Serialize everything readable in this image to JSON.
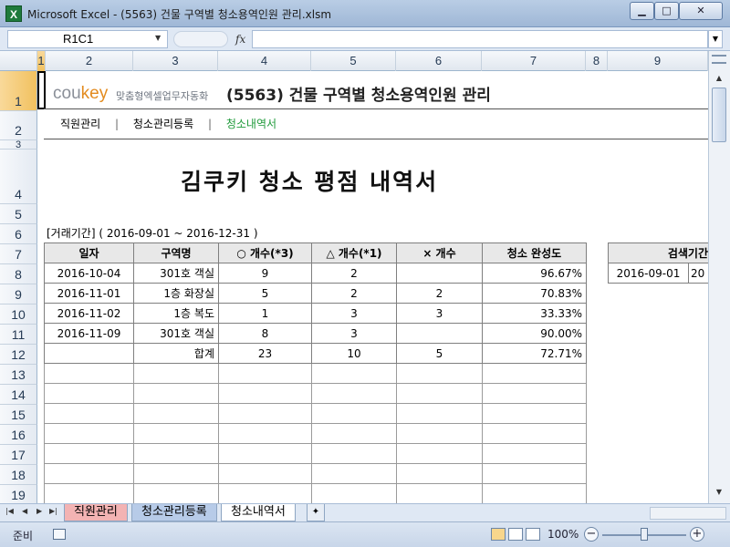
{
  "window": {
    "title": "Microsoft Excel - (5563) 건물 구역별 청소용역인원 관리.xlsm",
    "app_icon": "X",
    "minimize": "▁",
    "maximize": "□",
    "close": "✕"
  },
  "formula_bar": {
    "name_box": "R1C1",
    "fx": "fx",
    "value": ""
  },
  "columns": [
    "1",
    "2",
    "3",
    "4",
    "5",
    "6",
    "7",
    "8",
    "9"
  ],
  "rows": [
    "1",
    "2",
    "3",
    "4",
    "5",
    "6",
    "7",
    "8",
    "9",
    "10",
    "11",
    "12",
    "13",
    "14",
    "15",
    "16",
    "17",
    "18",
    "19"
  ],
  "header": {
    "brand_prefix": "cou",
    "brand_key": "key",
    "brand_sub": "맞춤형엑셀업무자동화",
    "title": "(5563) 건물 구역별 청소용역인원 관리"
  },
  "nav": {
    "items": [
      "직원관리",
      "청소관리등록",
      "청소내역서"
    ],
    "separator": "|"
  },
  "document": {
    "title": "김쿠키 청소 평점 내역서",
    "period_label": "[거래기간]",
    "period": "( 2016-09-01 ~ 2016-12-31 )"
  },
  "table": {
    "headers": [
      "일자",
      "구역명",
      "○ 개수(*3)",
      "△ 개수(*1)",
      "× 개수",
      "청소 완성도"
    ],
    "rows": [
      [
        "2016-10-04",
        "301호 객실",
        "9",
        "2",
        "",
        "96.67%"
      ],
      [
        "2016-11-01",
        "1층 화장실",
        "5",
        "2",
        "2",
        "70.83%"
      ],
      [
        "2016-11-02",
        "1층 복도",
        "1",
        "3",
        "3",
        "33.33%"
      ],
      [
        "2016-11-09",
        "301호 객실",
        "8",
        "3",
        "",
        "90.00%"
      ]
    ],
    "total": [
      "",
      "합계",
      "23",
      "10",
      "5",
      "72.71%"
    ]
  },
  "search": {
    "header": "검색기간",
    "from": "2016-09-01",
    "to": "20"
  },
  "sheet_tabs": [
    "직원관리",
    "청소관리등록",
    "청소내역서"
  ],
  "status": {
    "text": "준비",
    "zoom": "100%"
  },
  "colors": {
    "brand_accent": "#e38b1f",
    "nav_active": "#1f9a3a",
    "tab1": "#f3b3b3",
    "tab2": "#b7cbe8"
  }
}
